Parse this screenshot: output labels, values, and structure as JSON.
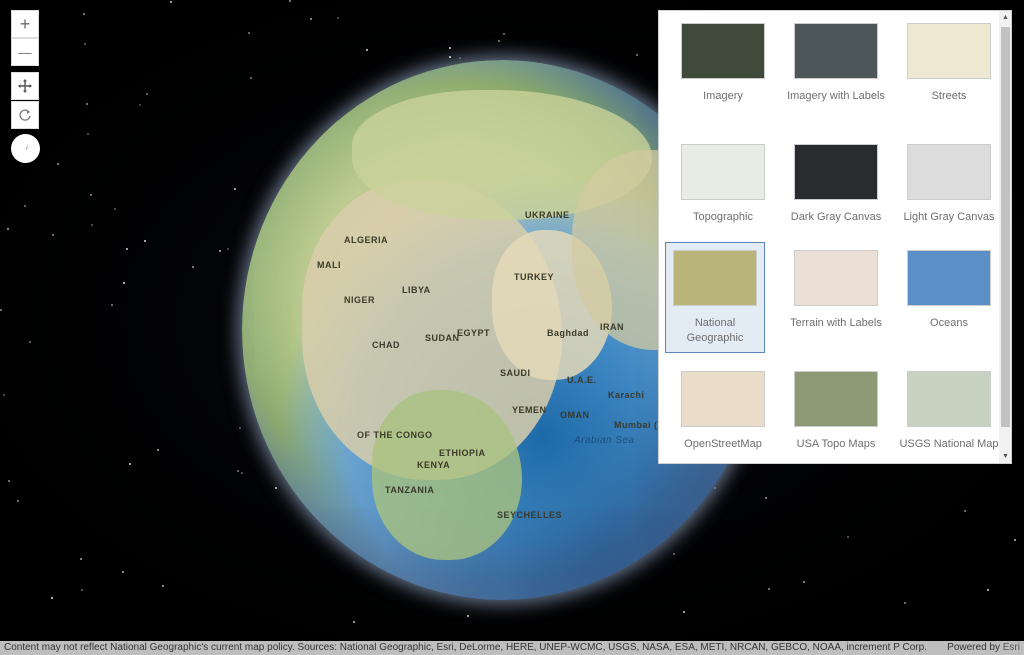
{
  "controls": {
    "zoom_in": "+",
    "zoom_out": "—",
    "pan_icon": "pan-icon",
    "rotate_icon": "rotate-icon",
    "compass_icon": "compass-icon"
  },
  "globe_labels": {
    "algeria": "ALGERIA",
    "libya": "LIBYA",
    "egypt": "EGYPT",
    "mali": "MALI",
    "niger": "NIGER",
    "chad": "CHAD",
    "sudan": "SUDAN",
    "saudi": "SAUDI",
    "iran": "IRAN",
    "turkey": "TURKEY",
    "ukraine": "UKRAINE",
    "yemen": "YEMEN",
    "oman": "OMAN",
    "kenya": "KENYA",
    "tanzania": "TANZANIA",
    "ethiopia": "ETHIOPIA",
    "congo": "OF THE CONGO",
    "seychelles": "SEYCHELLES",
    "arabian_sea": "Arabian Sea",
    "mumbai": "Mumbai (Bombay)",
    "karachi": "Karachi",
    "baghdad": "Baghdad",
    "uae": "U.A.E."
  },
  "gallery": {
    "items": [
      {
        "label": "Imagery",
        "thumb": "#3f4a3a"
      },
      {
        "label": "Imagery with Labels",
        "thumb": "#4d5658"
      },
      {
        "label": "Streets",
        "thumb": "#efe8d2"
      },
      {
        "label": "Topographic",
        "thumb": "#e8ece4"
      },
      {
        "label": "Dark Gray Canvas",
        "thumb": "#2a2b2e"
      },
      {
        "label": "Light Gray Canvas",
        "thumb": "#dcdcdc"
      },
      {
        "label": "National Geographic",
        "thumb": "#b9b57a"
      },
      {
        "label": "Terrain with Labels",
        "thumb": "#ecdfd6"
      },
      {
        "label": "Oceans",
        "thumb": "#5b8fc8"
      },
      {
        "label": "OpenStreetMap",
        "thumb": "#e9dcc8"
      },
      {
        "label": "USA Topo Maps",
        "thumb": "#8e9a76"
      },
      {
        "label": "USGS National Map",
        "thumb": "#c7d2c0"
      }
    ],
    "selected": "National Geographic"
  },
  "attribution": {
    "text": "Content may not reflect National Geographic's current map policy. Sources: National Geographic, Esri, DeLorme, HERE, UNEP-WCMC, USGS, NASA, ESA, METI, NRCAN, GEBCO, NOAA, increment P Corp.",
    "powered_by": "Powered by",
    "esri": "Esri"
  }
}
